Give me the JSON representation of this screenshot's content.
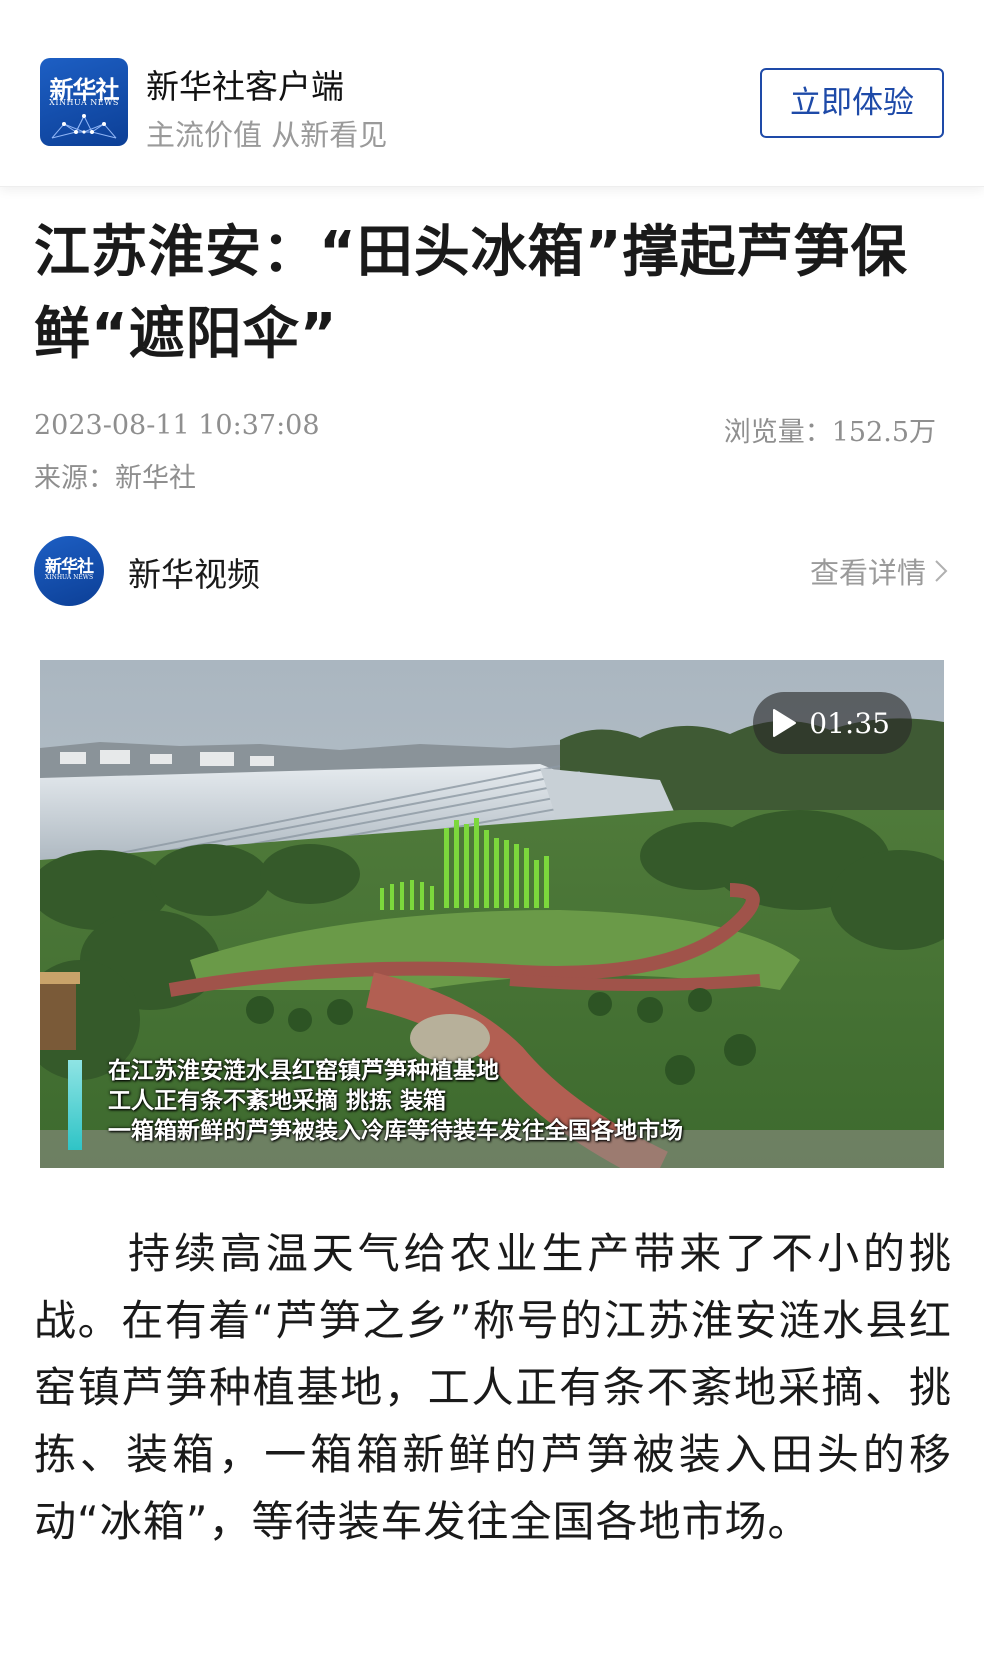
{
  "app_banner": {
    "logo_cn": "新华社",
    "logo_en": "XINHUA NEWS",
    "app_name": "新华社客户端",
    "slogan": "主流价值 从新看见",
    "try_button": "立即体验"
  },
  "article": {
    "title": "江苏淮安：“田头冰箱”撑起芦笋保鲜“遮阳伞”",
    "date": "2023-08-11 10:37:08",
    "views_label": "浏览量：",
    "views_value": "152.5万",
    "source": "来源：新华社",
    "body": "持续高温天气给农业生产带来了不小的挑战。在有着“芦笋之乡”称号的江苏淮安涟水县红窑镇芦笋种植基地，工人正有条不紊地采摘、挑拣、装箱，一箱箱新鲜的芦笋被装入田头的移动“冰箱”，等待装车发往全国各地市场。"
  },
  "channel": {
    "avatar_cn": "新华社",
    "avatar_en": "XINHUA NEWS",
    "name": "新华视频",
    "detail_link": "查看详情",
    "detail_icon": "chevron-right-icon"
  },
  "video": {
    "duration": "01:35",
    "play_icon": "play-icon",
    "subtitles": [
      "在江苏淮安涟水县红窑镇芦笋种植基地",
      "工人正有条不紊地采摘 挑拣 装箱",
      "一箱箱新鲜的芦笋被装入冷库等待装车发往全国各地市场"
    ]
  },
  "colors": {
    "brand_blue": "#1e4aa8",
    "muted_text": "#8f8f8f",
    "subtitle_accent": "#2fc4c6"
  }
}
